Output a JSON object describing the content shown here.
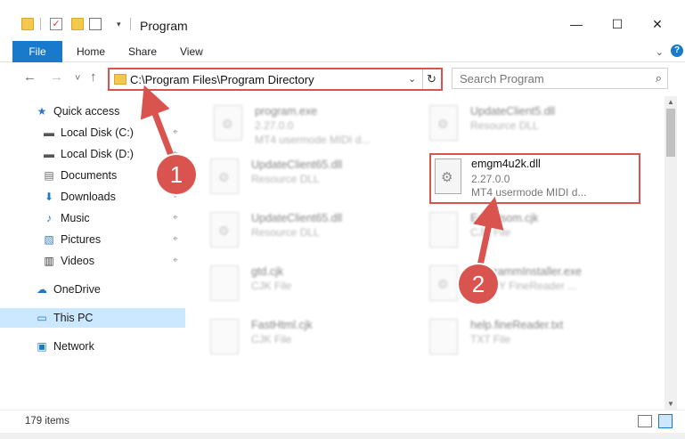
{
  "window": {
    "title": "Program",
    "minimize": "—",
    "maximize": "☐",
    "close": "✕"
  },
  "ribbon": {
    "tabs": [
      "File",
      "Home",
      "Share",
      "View"
    ],
    "collapse_glyph": "⌄",
    "help_glyph": "?"
  },
  "navigation": {
    "back": "←",
    "forward": "→",
    "recent": "˅",
    "up": "↑",
    "address": "C:\\Program Files\\Program Directory",
    "address_dropdown": "⌄",
    "refresh": "↻",
    "search_placeholder": "Search Program",
    "search_glyph": "⌕"
  },
  "sidebar": {
    "items": [
      {
        "label": "Quick access",
        "icon": "star-icon",
        "glyph": "★",
        "color": "#2a78c8",
        "pinned": false
      },
      {
        "label": "Local Disk (C:)",
        "icon": "disk-icon",
        "glyph": "▬",
        "color": "#555555",
        "pinned": true
      },
      {
        "label": "Local Disk (D:)",
        "icon": "disk-icon",
        "glyph": "▬",
        "color": "#555555",
        "pinned": true
      },
      {
        "label": "Documents",
        "icon": "documents-icon",
        "glyph": "▤",
        "color": "#6b6b6b",
        "pinned": true
      },
      {
        "label": "Downloads",
        "icon": "download-icon",
        "glyph": "⬇",
        "color": "#1979ca",
        "pinned": true
      },
      {
        "label": "Music",
        "icon": "music-icon",
        "glyph": "♪",
        "color": "#1979ca",
        "pinned": true
      },
      {
        "label": "Pictures",
        "icon": "pictures-icon",
        "glyph": "▧",
        "color": "#3a7bbf",
        "pinned": true
      },
      {
        "label": "Videos",
        "icon": "videos-icon",
        "glyph": "▥",
        "color": "#333333",
        "pinned": true
      },
      {
        "label": "OneDrive",
        "icon": "cloud-icon",
        "glyph": "☁",
        "color": "#1979ca",
        "pinned": false
      },
      {
        "label": "This PC",
        "icon": "computer-icon",
        "glyph": "▭",
        "color": "#1979ca",
        "pinned": false
      },
      {
        "label": "Network",
        "icon": "network-icon",
        "glyph": "▣",
        "color": "#1979ca",
        "pinned": false
      }
    ],
    "pin_glyph": "⌖"
  },
  "files": [
    {
      "name": "program.exe",
      "line1": "2.27.0.0",
      "line2": "MT4 usermode MIDI d..."
    },
    {
      "name": "UpdateClient5.dll",
      "line1": "Resource DLL",
      "line2": ""
    },
    {
      "name": "UpdateClient65.dll",
      "line1": "Resource DLL",
      "line2": ""
    },
    {
      "name": "UpdateClient65.dll",
      "line1": "Resource DLL",
      "line2": ""
    },
    {
      "name": "Ecosysom.cjk",
      "line1": "CJK File",
      "line2": ""
    },
    {
      "name": "gtd.cjk",
      "line1": "CJK File",
      "line2": ""
    },
    {
      "name": "ProgrammInstaller.exe",
      "line1": "ABBYY FineReader ...",
      "line2": ""
    },
    {
      "name": "FastHtml.cjk",
      "line1": "CJK File",
      "line2": ""
    },
    {
      "name": "help.fineReader.txt",
      "line1": "TXT File",
      "line2": ""
    }
  ],
  "highlighted_file": {
    "name": "emgm4u2k.dll",
    "version": "2.27.0.0",
    "description": "MT4 usermode MIDI d..."
  },
  "status": {
    "item_count": "179 items"
  },
  "annotations": {
    "step1": "1",
    "step2": "2",
    "color": "#d9534f"
  }
}
